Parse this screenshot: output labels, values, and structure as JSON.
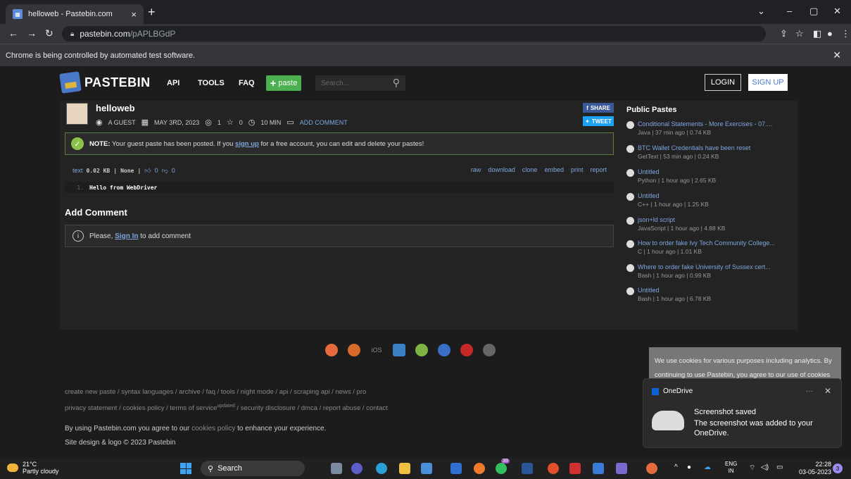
{
  "browser": {
    "tab_title": "helloweb - Pastebin.com",
    "url_host": "pastebin.com",
    "url_path": "/pAPLBGdP",
    "infobar_text": "Chrome is being controlled by automated test software."
  },
  "header": {
    "logo": "PASTEBIN",
    "menu": [
      "API",
      "TOOLS",
      "FAQ"
    ],
    "paste_label": "paste",
    "search_placeholder": "Search...",
    "login": "LOGIN",
    "signup": "SIGN UP"
  },
  "paste": {
    "title": "helloweb",
    "author": "A GUEST",
    "date": "MAY 3RD, 2023",
    "views": "1",
    "stars": "0",
    "expires": "10 MIN",
    "add_comment": "ADD COMMENT",
    "share": "SHARE",
    "tweet": "TWEET",
    "notice_bold": "NOTE:",
    "notice_before": "Your guest paste has been posted. If you",
    "notice_link": "sign up",
    "notice_after": "for a free account, you can edit and delete your pastes!",
    "syntax": "text",
    "size": "0.02 KB",
    "category": "None",
    "likes": "0",
    "dislikes": "0",
    "actions": [
      "raw",
      "download",
      "clone",
      "embed",
      "print",
      "report"
    ],
    "lines": [
      {
        "num": "1.",
        "text": "Hello from WebDriver"
      }
    ]
  },
  "comments": {
    "heading": "Add Comment",
    "prompt_before": "Please,",
    "prompt_link": "Sign In",
    "prompt_after": "to add comment"
  },
  "public_pastes": {
    "heading": "Public Pastes",
    "items": [
      {
        "title": "Conditional Statements - More Exercises - 07....",
        "sub": "Java | 37 min ago | 0.74 KB"
      },
      {
        "title": "BTC Wallet Credentials have been reset",
        "sub": "GetText | 53 min ago | 0.24 KB"
      },
      {
        "title": "Untitled",
        "sub": "Python | 1 hour ago | 2.65 KB"
      },
      {
        "title": "Untitled",
        "sub": "C++ | 1 hour ago | 1.25 KB"
      },
      {
        "title": "json+ld script",
        "sub": "JavaScript | 1 hour ago | 4.88 KB"
      },
      {
        "title": "How to order fake Ivy Tech Community College...",
        "sub": "C | 1 hour ago | 1.01 KB"
      },
      {
        "title": "Where to order fake University of Sussex cert...",
        "sub": "Bash | 1 hour ago | 0.99 KB"
      },
      {
        "title": "Untitled",
        "sub": "Bash | 1 hour ago | 6.78 KB"
      }
    ]
  },
  "footer": {
    "ios_label": "iOS",
    "links_line1": "create new paste / syntax languages / archive / faq / tools / night mode / api / scraping api / news / pro",
    "links_line2_a": "privacy statement / cookies policy / terms of service",
    "links_line2_sup": "updated",
    "links_line2_b": "/ security disclosure / dmca / report abuse / contact",
    "note_before": "By using Pastebin.com you agree to our",
    "note_link": "cookies policy",
    "note_after": "to enhance your experience.",
    "copyright": "Site design & logo © 2023 Pastebin"
  },
  "cookie_banner": "We use cookies for various purposes including analytics. By continuing to use Pastebin, you agree to our use of cookies as",
  "onedrive": {
    "app": "OneDrive",
    "title": "Screenshot saved",
    "body": "The screenshot was added to your OneDrive."
  },
  "taskbar": {
    "temp": "21°C",
    "weather": "Partly cloudy",
    "search": "Search",
    "lang1": "ENG",
    "lang2": "IN",
    "time": "22:28",
    "date": "03-05-2023",
    "whatsapp_badge": "39",
    "notif_count": "3"
  }
}
